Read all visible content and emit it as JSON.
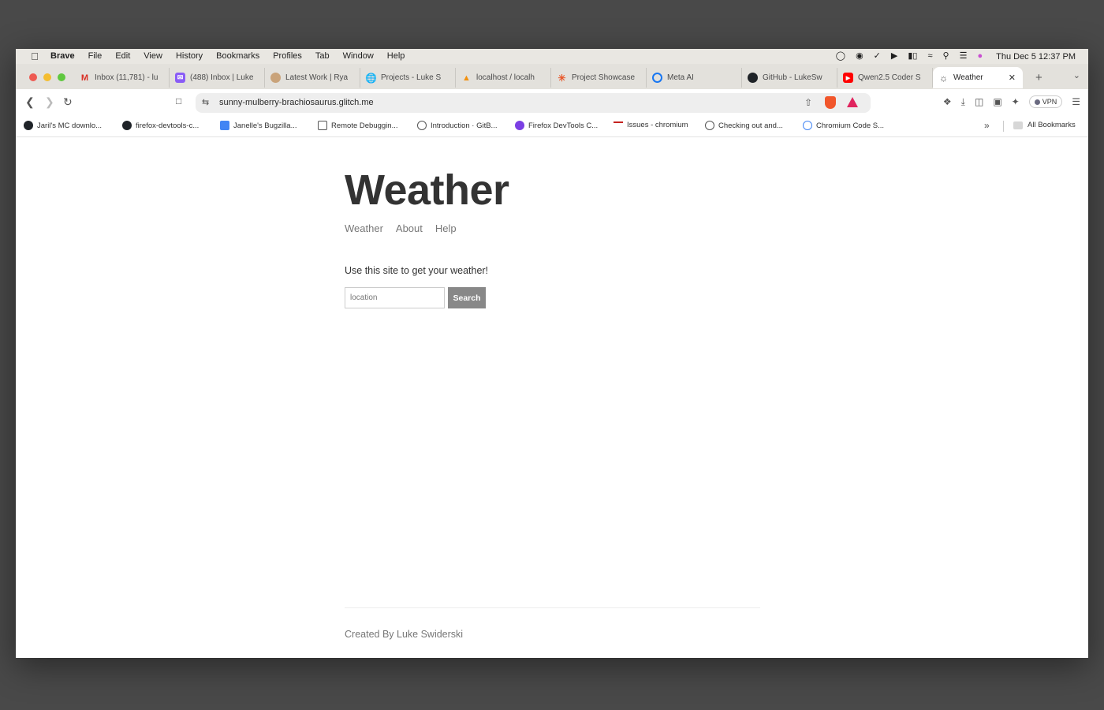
{
  "menubar": {
    "app": "Brave",
    "items": [
      "File",
      "Edit",
      "View",
      "History",
      "Bookmarks",
      "Profiles",
      "Tab",
      "Window",
      "Help"
    ],
    "clock": "Thu Dec 5  12:37 PM"
  },
  "tabs": [
    {
      "label": "Inbox (11,781) - lu",
      "icon": "gmail-icon",
      "color": "#d93025"
    },
    {
      "label": "(488) Inbox | Luke",
      "icon": "proton-mail-icon",
      "color": "#8a5cf6"
    },
    {
      "label": "Latest Work | Rya",
      "icon": "avatar-icon",
      "color": "#c9a37a"
    },
    {
      "label": "Projects - Luke S",
      "icon": "globe-icon",
      "color": "#555555"
    },
    {
      "label": "localhost / localh",
      "icon": "phpmyadmin-icon",
      "color": "#f29111"
    },
    {
      "label": "Project Showcase",
      "icon": "sparkle-icon",
      "color": "#e8592b"
    },
    {
      "label": "Meta AI",
      "icon": "meta-ai-icon",
      "color": "#1877f2"
    },
    {
      "label": "GitHub - LukeSw",
      "icon": "github-icon",
      "color": "#1f2328"
    },
    {
      "label": "Qwen2.5 Coder S",
      "icon": "youtube-icon",
      "color": "#ff0000"
    },
    {
      "label": "Weather",
      "icon": "weather-icon",
      "color": "#444444",
      "active": true
    }
  ],
  "toolbar": {
    "url": "sunny-mulberry-brachiosaurus.glitch.me",
    "vpn_label": "VPN"
  },
  "bookmarks": [
    {
      "label": "Jaril's MC downlo...",
      "icon": "github-icon",
      "color": "#1f2328"
    },
    {
      "label": "firefox-devtools-c...",
      "icon": "github-icon",
      "color": "#1f2328"
    },
    {
      "label": "Janelle's Bugzilla...",
      "icon": "docs-icon",
      "color": "#4285f4"
    },
    {
      "label": "Remote Debuggin...",
      "icon": "book-icon",
      "color": "#555555"
    },
    {
      "label": "Introduction · GitB...",
      "icon": "globe-icon",
      "color": "#555555"
    },
    {
      "label": "Firefox DevTools C...",
      "icon": "firefox-icon",
      "color": "#7b3fe4"
    },
    {
      "label": "Issues - chromium",
      "icon": "chromium-issues-icon",
      "color": "#c5221f"
    },
    {
      "label": "Checking out and...",
      "icon": "globe-icon",
      "color": "#555555"
    },
    {
      "label": "Chromium Code S...",
      "icon": "code-search-icon",
      "color": "#4285f4"
    }
  ],
  "all_bookmarks": "All Bookmarks",
  "page": {
    "title": "Weather",
    "nav": [
      "Weather",
      "About",
      "Help"
    ],
    "intro": "Use this site to get your weather!",
    "search": {
      "placeholder": "location",
      "button": "Search"
    },
    "footer": "Created By Luke Swiderski"
  }
}
